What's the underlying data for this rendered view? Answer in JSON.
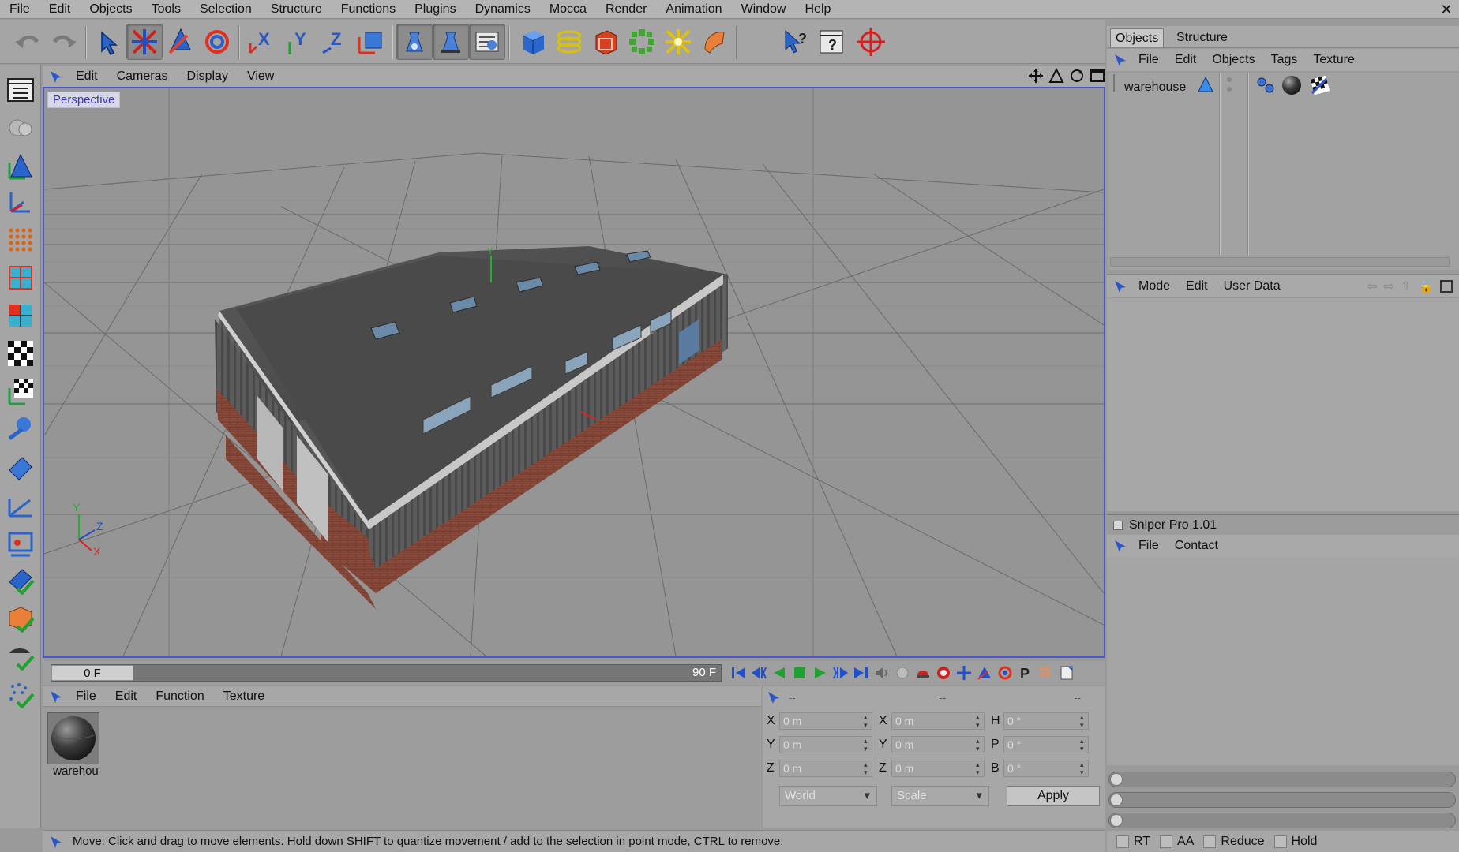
{
  "menubar": {
    "items": [
      "File",
      "Edit",
      "Objects",
      "Tools",
      "Selection",
      "Structure",
      "Functions",
      "Plugins",
      "Dynamics",
      "Mocca",
      "Render",
      "Animation",
      "Window",
      "Help"
    ]
  },
  "toolbar": {
    "buttons": [
      "undo-icon",
      "redo-icon",
      "live-selection-icon",
      "move-icon",
      "scale-icon",
      "rotate-icon",
      "x-axis-lock-icon",
      "y-axis-lock-icon",
      "z-axis-lock-icon",
      "coordinate-system-icon",
      "render-view-icon",
      "render-active-icon",
      "render-settings-icon",
      "cube-primitive-icon",
      "spline-icon",
      "nurbs-icon",
      "modeling-array-icon",
      "deformer-icon",
      "scene-light-icon",
      "camera-icon",
      "help-pointer-icon",
      "help-context-icon",
      "target-icon"
    ]
  },
  "left_toolbar": {
    "buttons": [
      "make-editable-icon",
      "object-tool-icon",
      "use-model-tool-icon",
      "use-object-axis-icon",
      "points-mode-icon",
      "edges-mode-icon",
      "polygons-mode-icon",
      "texture-mode-icon",
      "texture-axis-icon",
      "workplane-icon",
      "sculpt-icon",
      "animation-mode-icon",
      "inverse-kinematics-icon",
      "select-children-icon",
      "edit-render-settings-icon",
      "render-check-icon",
      "material-check-icon",
      "particles-check-icon"
    ]
  },
  "viewport": {
    "menu": [
      "Edit",
      "Cameras",
      "Display",
      "View"
    ],
    "label": "Perspective",
    "axis_y": "Y",
    "axis_z": "Z",
    "axis_x": "X"
  },
  "timeline": {
    "start": "0 F",
    "end": "90 F",
    "progress": 0
  },
  "material_manager": {
    "menu": [
      "File",
      "Edit",
      "Function",
      "Texture"
    ],
    "material_name": "warehou"
  },
  "coordinates": {
    "header": [
      "--",
      "--",
      "--"
    ],
    "rows": [
      {
        "l1": "X",
        "v1": "0 m",
        "l2": "X",
        "v2": "0 m",
        "l3": "H",
        "v3": "0 °"
      },
      {
        "l1": "Y",
        "v1": "0 m",
        "l2": "Y",
        "v2": "0 m",
        "l3": "P",
        "v3": "0 °"
      },
      {
        "l1": "Z",
        "v1": "0 m",
        "l2": "Z",
        "v2": "0 m",
        "l3": "B",
        "v3": "0 °"
      }
    ],
    "mode": "World",
    "size_mode": "Scale",
    "apply_label": "Apply"
  },
  "status": {
    "text": "Move: Click and drag to move elements. Hold down SHIFT to quantize movement / add to the selection in point mode, CTRL to remove."
  },
  "objects_panel": {
    "tabs": [
      "Objects",
      "Structure"
    ],
    "menu": [
      "File",
      "Edit",
      "Objects",
      "Tags",
      "Texture"
    ],
    "object_name": "warehouse"
  },
  "attributes_panel": {
    "menu": [
      "Mode",
      "Edit",
      "User Data"
    ]
  },
  "sniper_panel": {
    "title": "Sniper Pro 1.01",
    "menu": [
      "File",
      "Contact"
    ]
  },
  "render_bar": {
    "options": [
      "RT",
      "AA",
      "Reduce",
      "Hold"
    ]
  },
  "colors": {
    "viewport_border": "#4a55cc",
    "perspective_label": "#3a3ab0",
    "background": "#9a9a9a"
  }
}
